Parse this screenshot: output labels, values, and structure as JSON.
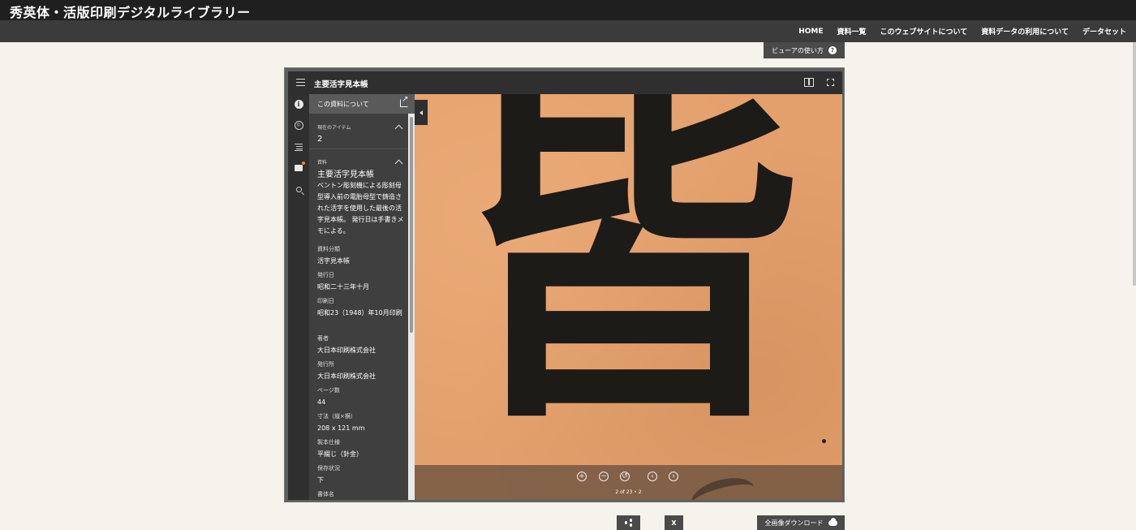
{
  "site": {
    "title": "秀英体・活版印刷デジタルライブラリー",
    "nav": [
      "HOME",
      "資料一覧",
      "このウェブサイトについて",
      "資料データの利用について",
      "データセット"
    ]
  },
  "help": {
    "label": "ビューアの使い方",
    "icon": "question-icon"
  },
  "viewer": {
    "title": "主要活字見本帳",
    "panel": {
      "header": "この資料について",
      "current_item_label": "現在のアイテム",
      "current_item_value": "2",
      "resource_label": "資料",
      "resource_title": "主要活字見本帳",
      "description": "ベントン彫刻機による彫刻母型導入前の電胎母型で鋳造された活字を使用した最後の活字見本帳。 発行日は手書きメモによる。",
      "metadata": [
        {
          "key": "資料分類",
          "value": "活字見本帳"
        },
        {
          "key": "発行日",
          "value": "昭和二十三年十月"
        },
        {
          "key": "印刷日",
          "value": "昭和23（1948）年10月印刷"
        },
        {
          "key": "著者",
          "value": "大日本印刷株式会社"
        },
        {
          "key": "発行所",
          "value": "大日本印刷株式会社"
        },
        {
          "key": "ページ数",
          "value": "44"
        },
        {
          "key": "寸法（縦×横）",
          "value": "208 x 121 mm"
        },
        {
          "key": "製本仕様",
          "value": "平綴じ（針金）"
        },
        {
          "key": "保存状況",
          "value": "下"
        },
        {
          "key": "書体名",
          "value": ""
        }
      ]
    },
    "image_glyph": "皆",
    "pager": "2 of 23 • 2",
    "controls": [
      "zoom-in-icon",
      "zoom-out-icon",
      "reset-icon",
      "prev-icon",
      "next-icon"
    ]
  },
  "footer": {
    "share_icon": "share-icon",
    "x_label": "X",
    "download_label": "全画像ダウンロード",
    "download_icon": "cloud-download-icon"
  }
}
